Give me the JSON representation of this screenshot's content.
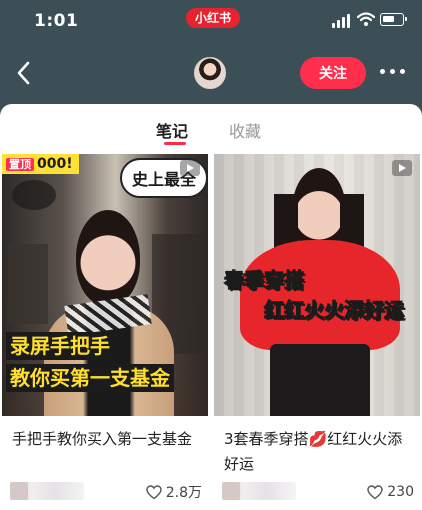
{
  "status_bar": {
    "time": "1:01",
    "app_name": "小红书",
    "icons": [
      "signal-icon",
      "wifi-icon",
      "battery-icon"
    ]
  },
  "header": {
    "back_icon": "chevron-left-icon",
    "follow_label": "关注",
    "more_icon": "more-dots-icon"
  },
  "tabs": [
    {
      "label": "笔记",
      "active": true
    },
    {
      "label": "收藏",
      "active": false
    }
  ],
  "notes": [
    {
      "cover_top_banner": "000!",
      "cover_top_badge": "置顶",
      "cover_bubble": "史上最全",
      "cover_caption_lines": [
        "录屏手把手",
        "教你买第一支基金"
      ],
      "title": "手把手教你买入第一支基金",
      "likes": "2.8万",
      "is_video": true
    },
    {
      "cover_caption_lines": [
        "春季穿搭",
        "红红火火添好运"
      ],
      "title": "3套春季穿搭💋红红火火添好运",
      "likes": "230",
      "is_video": true
    }
  ],
  "colors": {
    "accent": "#ff2e4d",
    "header_bg": "#3d4f56",
    "caption_yellow": "#ffdf2e"
  }
}
